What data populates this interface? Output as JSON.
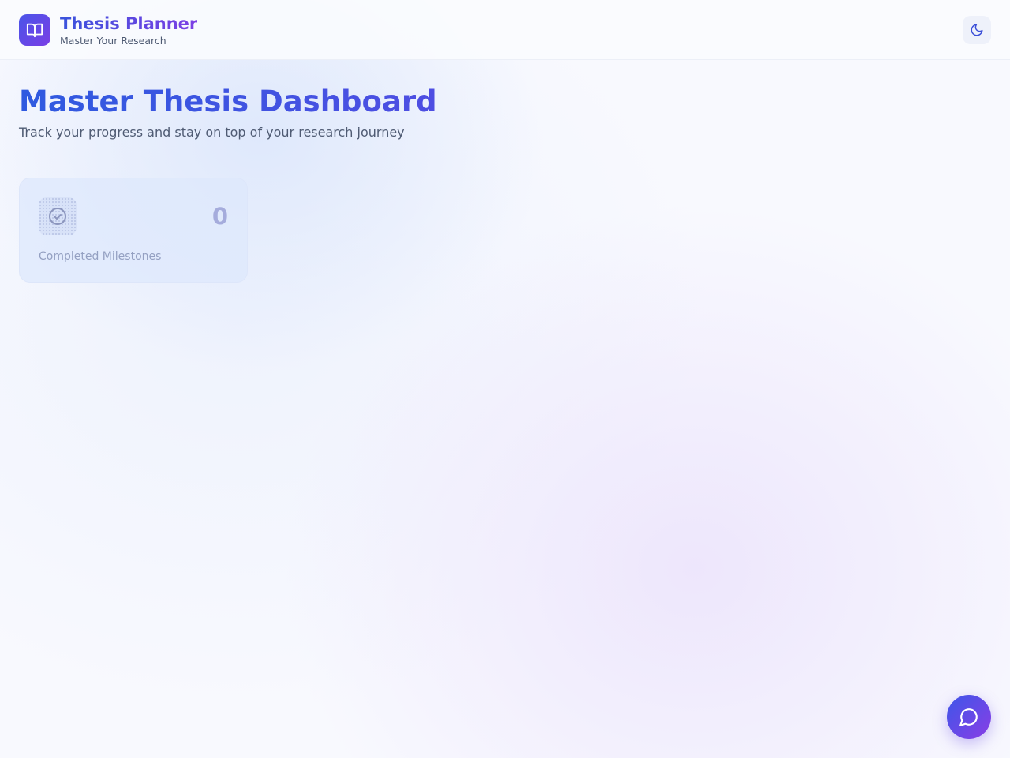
{
  "header": {
    "app_title": "Thesis Planner",
    "app_subtitle": "Master Your Research",
    "logo_icon": "book-open-icon",
    "theme_toggle_icon": "moon-icon"
  },
  "hero": {
    "title": "Master Thesis Dashboard",
    "subtitle": "Track your progress and stay on top of your research journey"
  },
  "stats": [
    {
      "icon": "check-circle-icon",
      "value": "0",
      "label": "Completed Milestones"
    }
  ],
  "chat_button": {
    "icon": "message-circle-icon"
  },
  "colors": {
    "accent_start": "#3d56e8",
    "accent_end": "#8a3ee6",
    "background": "#f8f9fe",
    "card_background": "#dee8fc"
  }
}
